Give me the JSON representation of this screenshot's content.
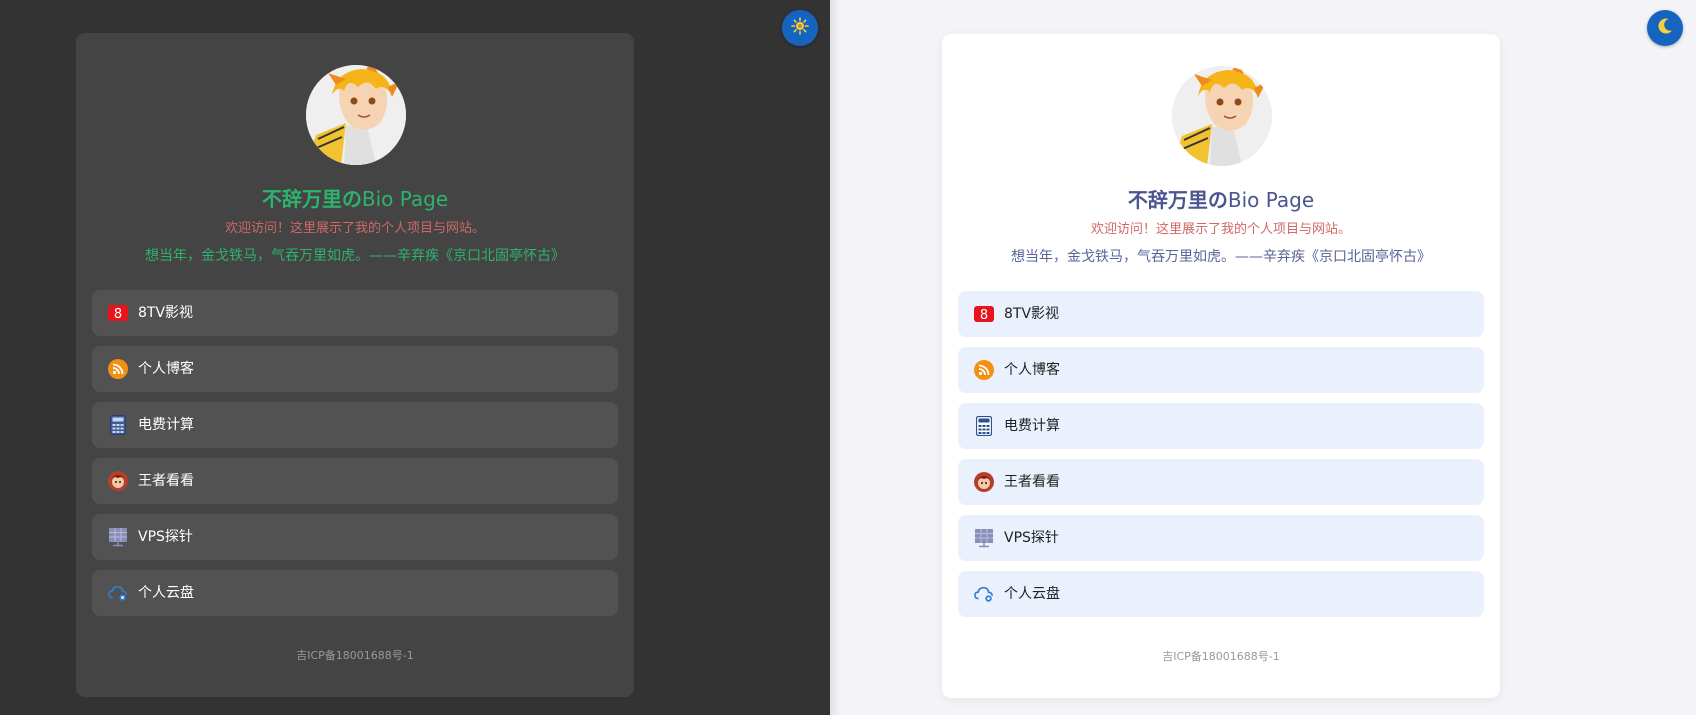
{
  "title_zh": "不辞万里の",
  "title_en": "Bio Page",
  "subtitle": "欢迎访问！这里展示了我的个人项目与网站。",
  "quote": "想当年，金戈铁马，气吞万里如虎。——辛弃疾《京口北固亭怀古》",
  "links": [
    {
      "label": "8TV影视",
      "icon": "8tv-icon"
    },
    {
      "label": "个人博客",
      "icon": "rss-icon"
    },
    {
      "label": "电费计算",
      "icon": "calculator-icon"
    },
    {
      "label": "王者看看",
      "icon": "game-avatar-icon"
    },
    {
      "label": "VPS探针",
      "icon": "server-icon"
    },
    {
      "label": "个人云盘",
      "icon": "cloud-icon"
    }
  ],
  "footer": "吉ICP备18001688号-1",
  "icons": {
    "8tv": "8",
    "dark_toggle": "sun-icon",
    "light_toggle": "moon-icon"
  },
  "colors": {
    "dark_bg": "#333333",
    "dark_card": "#444444",
    "dark_link": "#525252",
    "dark_accent": "#2db36f",
    "light_bg": "#f3f3f8",
    "light_card": "#ffffff",
    "light_link": "#eaf1fd",
    "light_accent": "#4a5591",
    "subtitle": "#d16767",
    "toggle": "#1565c0"
  }
}
